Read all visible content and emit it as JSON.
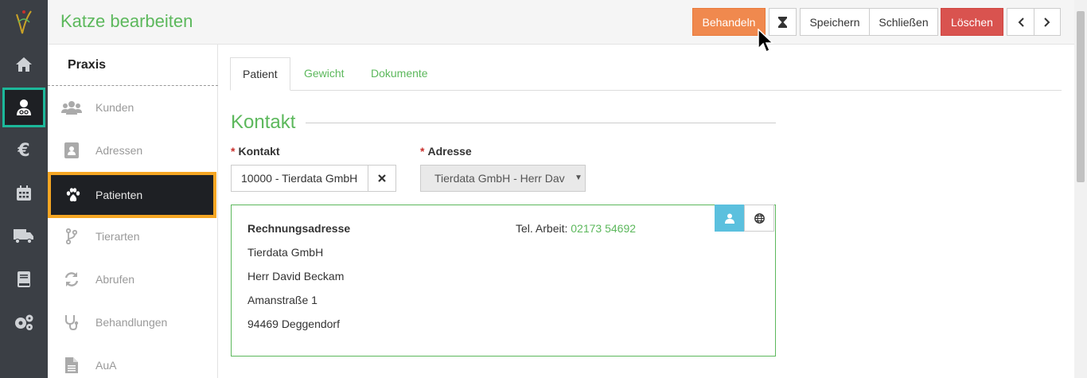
{
  "page_title": "Katze bearbeiten",
  "toolbar": {
    "behandeln": "Behandeln",
    "speichern": "Speichern",
    "schliessen": "Schließen",
    "loeschen": "Löschen"
  },
  "nav_icons": [
    "logo-icon",
    "home-icon",
    "vet-user-icon",
    "euro-icon",
    "calendar-icon",
    "truck-icon",
    "book-icon",
    "cogs-icon"
  ],
  "submenu": {
    "title": "Praxis",
    "items": [
      {
        "label": "Kunden",
        "icon": "users-icon"
      },
      {
        "label": "Adressen",
        "icon": "address-book-icon"
      },
      {
        "label": "Patienten",
        "icon": "paw-icon"
      },
      {
        "label": "Tierarten",
        "icon": "branch-icon"
      },
      {
        "label": "Abrufen",
        "icon": "refresh-icon"
      },
      {
        "label": "Behandlungen",
        "icon": "stethoscope-icon"
      },
      {
        "label": "AuA",
        "icon": "file-icon"
      }
    ]
  },
  "tabs": [
    "Patient",
    "Gewicht",
    "Dokumente"
  ],
  "section_title": "Kontakt",
  "fields": {
    "kontakt_label": "Kontakt",
    "kontakt_value": "10000 - Tierdata GmbH",
    "adresse_label": "Adresse",
    "adresse_value": "Tierdata GmbH - Herr Dav"
  },
  "address": {
    "heading": "Rechnungsadresse",
    "company": "Tierdata GmbH",
    "person": "Herr David Beckam",
    "street": "Amanstraße 1",
    "city": "94469 Deggendorf",
    "phone_label": "Tel. Arbeit:",
    "phone_number": "02173 54692"
  },
  "colors": {
    "accent_green": "#5cb85c",
    "orange": "#f0894e",
    "red": "#d9534f",
    "teal": "#1cb89a",
    "highlight": "#f5a623"
  }
}
